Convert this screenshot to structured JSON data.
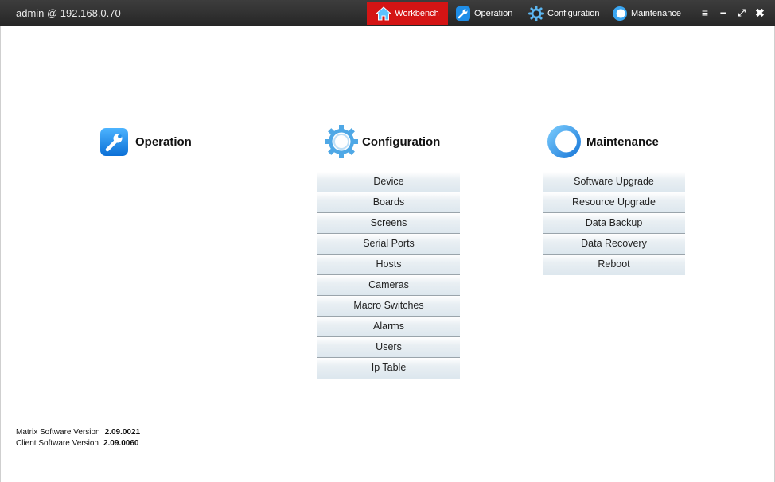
{
  "header": {
    "session": "admin @ 192.168.0.70",
    "tabs": [
      {
        "label": "Workbench",
        "icon": "home-icon",
        "active": true
      },
      {
        "label": "Operation",
        "icon": "wrench-icon"
      },
      {
        "label": "Configuration",
        "icon": "gear-icon"
      },
      {
        "label": "Maintenance",
        "icon": "ring-icon"
      }
    ],
    "window_controls": [
      "menu-icon",
      "minimize-icon",
      "maximize-icon",
      "close-icon"
    ]
  },
  "sections": {
    "operation": {
      "title": "Operation",
      "icon": "wrench-icon"
    },
    "configuration": {
      "title": "Configuration",
      "icon": "gear-icon",
      "items": [
        "Device",
        "Boards",
        "Screens",
        "Serial Ports",
        "Hosts",
        "Cameras",
        "Macro Switches",
        "Alarms",
        "Users",
        "Ip Table"
      ]
    },
    "maintenance": {
      "title": "Maintenance",
      "icon": "ring-icon",
      "items": [
        "Software Upgrade",
        "Resource Upgrade",
        "Data Backup",
        "Data Recovery",
        "Reboot"
      ]
    }
  },
  "footer": {
    "matrix_label": "Matrix Software Version",
    "matrix_version": "2.09.0021",
    "client_label": "Client Software Version",
    "client_version": "2.09.0060"
  },
  "colors": {
    "titlebar": "#2e2e2e",
    "active_tab": "#d41414",
    "accent_blue": "#1f8ee8"
  }
}
